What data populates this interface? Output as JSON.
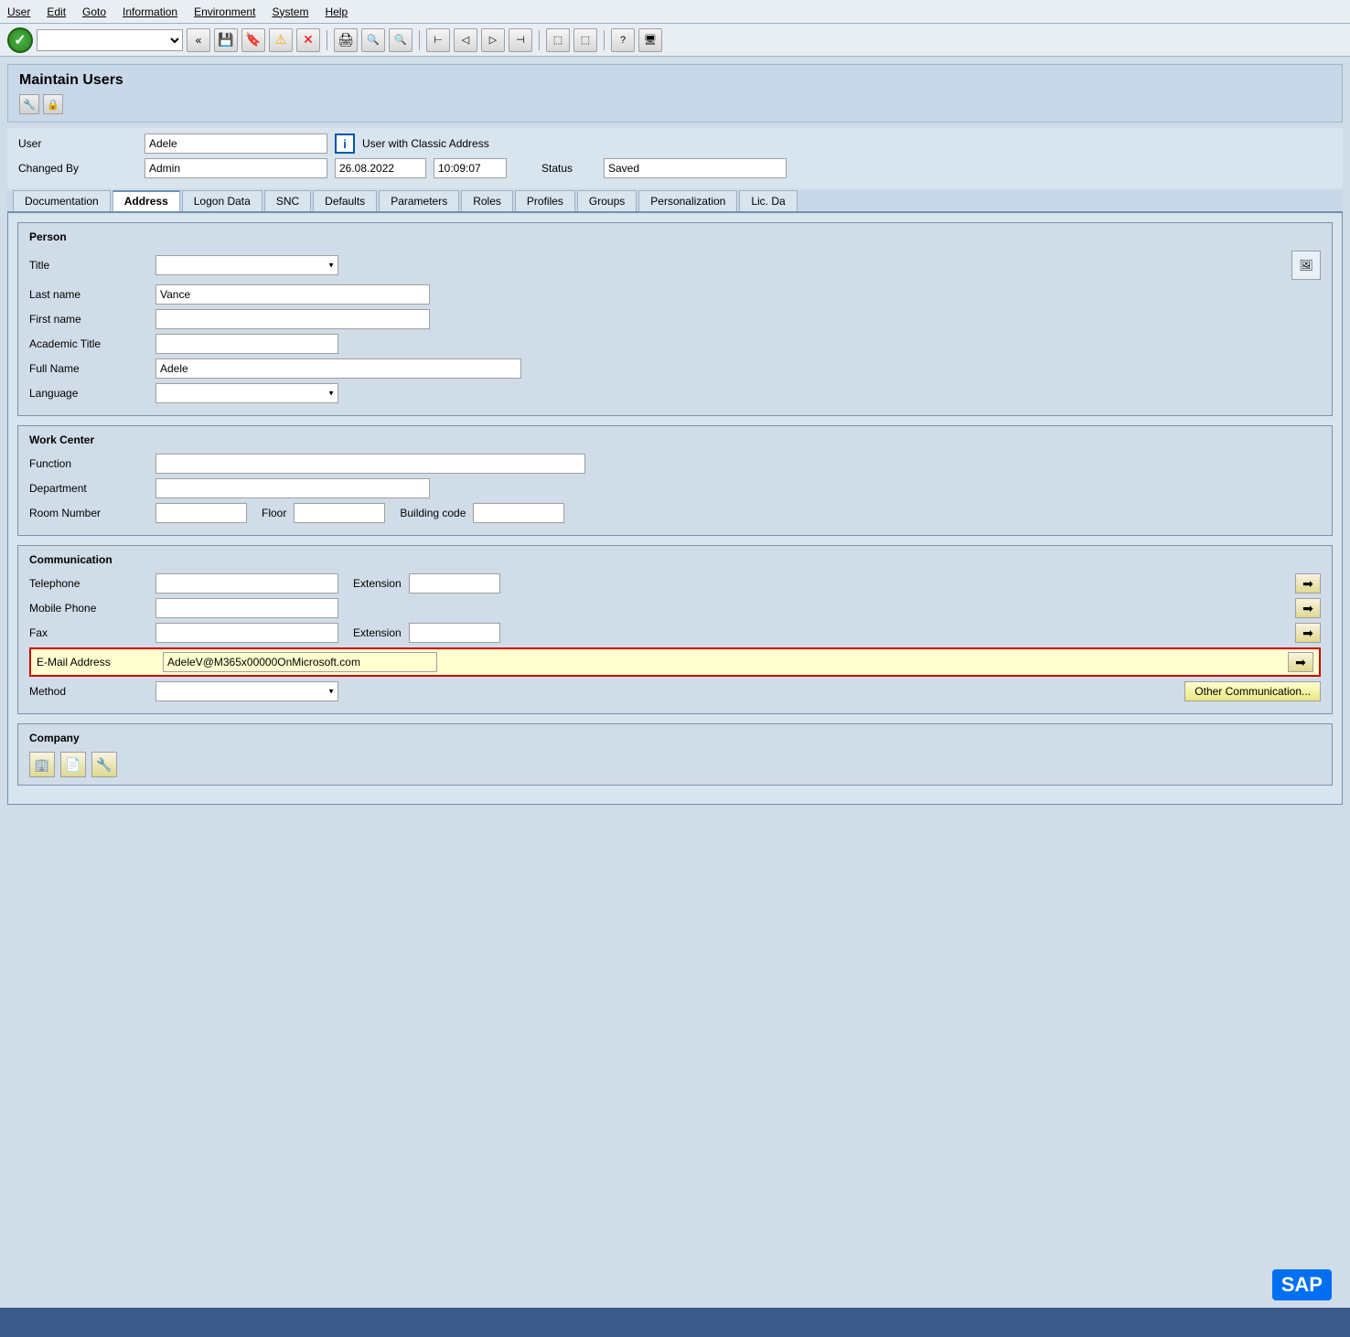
{
  "menubar": {
    "items": [
      {
        "id": "user",
        "label": "User"
      },
      {
        "id": "edit",
        "label": "Edit"
      },
      {
        "id": "goto",
        "label": "Goto"
      },
      {
        "id": "information",
        "label": "Information"
      },
      {
        "id": "environment",
        "label": "Environment"
      },
      {
        "id": "system",
        "label": "System"
      },
      {
        "id": "help",
        "label": "Help"
      }
    ]
  },
  "toolbar": {
    "combo_placeholder": ""
  },
  "page": {
    "title": "Maintain Users"
  },
  "user_info": {
    "user_label": "User",
    "user_value": "Adele",
    "info_icon": "i",
    "classic_address": "User with Classic Address",
    "changed_by_label": "Changed By",
    "changed_by_value": "Admin",
    "date_value": "26.08.2022",
    "time_value": "10:09:07",
    "status_label": "Status",
    "status_value": "Saved"
  },
  "tabs": [
    {
      "id": "documentation",
      "label": "Documentation",
      "active": false
    },
    {
      "id": "address",
      "label": "Address",
      "active": true
    },
    {
      "id": "logon_data",
      "label": "Logon Data",
      "active": false
    },
    {
      "id": "snc",
      "label": "SNC",
      "active": false
    },
    {
      "id": "defaults",
      "label": "Defaults",
      "active": false
    },
    {
      "id": "parameters",
      "label": "Parameters",
      "active": false
    },
    {
      "id": "roles",
      "label": "Roles",
      "active": false
    },
    {
      "id": "profiles",
      "label": "Profiles",
      "active": false
    },
    {
      "id": "groups",
      "label": "Groups",
      "active": false
    },
    {
      "id": "personalization",
      "label": "Personalization",
      "active": false
    },
    {
      "id": "lic_data",
      "label": "Lic. Da",
      "active": false
    }
  ],
  "person_section": {
    "title": "Person",
    "fields": {
      "title_label": "Title",
      "title_value": "",
      "last_name_label": "Last name",
      "last_name_value": "Vance",
      "first_name_label": "First name",
      "first_name_value": "",
      "academic_title_label": "Academic Title",
      "academic_title_value": "",
      "full_name_label": "Full Name",
      "full_name_value": "Adele",
      "language_label": "Language",
      "language_value": ""
    }
  },
  "work_center_section": {
    "title": "Work Center",
    "fields": {
      "function_label": "Function",
      "function_value": "",
      "department_label": "Department",
      "department_value": "",
      "room_number_label": "Room Number",
      "room_number_value": "",
      "floor_label": "Floor",
      "floor_value": "",
      "building_code_label": "Building code",
      "building_code_value": ""
    }
  },
  "communication_section": {
    "title": "Communication",
    "fields": {
      "telephone_label": "Telephone",
      "telephone_value": "",
      "extension_label": "Extension",
      "extension_value": "",
      "mobile_phone_label": "Mobile Phone",
      "mobile_phone_value": "",
      "fax_label": "Fax",
      "fax_value": "",
      "fax_extension_label": "Extension",
      "fax_extension_value": "",
      "email_label": "E-Mail Address",
      "email_value": "AdeleV@M365x00000OnMicrosoft.com",
      "method_label": "Method",
      "method_value": "",
      "other_comm_btn": "Other Communication..."
    }
  },
  "company_section": {
    "title": "Company"
  },
  "sap_logo": "SAP"
}
